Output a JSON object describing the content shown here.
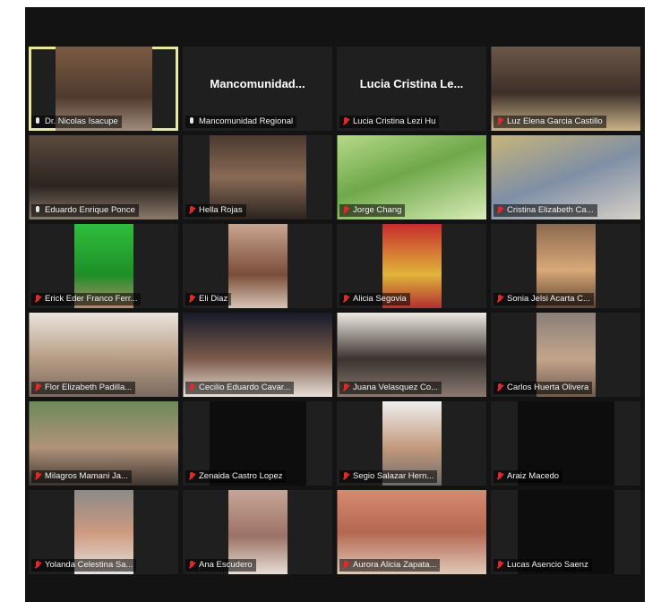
{
  "app": {
    "name": "Zoom",
    "view": "Gallery View"
  },
  "colors": {
    "background": "#131313",
    "tile": "#1f1f1f",
    "active_speaker": "#e8e8a0",
    "muted_mic": "#e02a2a"
  },
  "participants": [
    {
      "name": "Dr. Nicolas Isacupe",
      "muted": false,
      "active": true,
      "video": "on",
      "swatch": 0
    },
    {
      "name": "Mancomunidad Regional",
      "display_title": "Mancomunidad...",
      "muted": false,
      "video": "off"
    },
    {
      "name": "Lucia Cristina Lezi Hu",
      "display_title": "Lucia Cristina Le...",
      "muted": true,
      "video": "off"
    },
    {
      "name": "Luz Elena Garcia Castillo",
      "muted": true,
      "video": "on",
      "swatch": 1
    },
    {
      "name": "Eduardo Enrique Ponce",
      "muted": false,
      "video": "on",
      "swatch": 2
    },
    {
      "name": "Hella Rojas",
      "muted": true,
      "video": "on",
      "swatch": 10
    },
    {
      "name": "Jorge Chang",
      "muted": true,
      "video": "on",
      "swatch": 3
    },
    {
      "name": "Cristina Elizabeth Ca...",
      "muted": true,
      "video": "on",
      "swatch": 13
    },
    {
      "name": "Erick Eder Franco Ferr...",
      "muted": true,
      "video": "on",
      "swatch": 5
    },
    {
      "name": "Eli Diaz",
      "muted": true,
      "video": "on",
      "swatch": 6
    },
    {
      "name": "Alicia Segovia",
      "muted": true,
      "video": "on",
      "swatch": 7
    },
    {
      "name": "Sonia Jelsi Acarta C...",
      "muted": true,
      "video": "on",
      "swatch": 8
    },
    {
      "name": "Flor Elizabeth Padilla...",
      "muted": true,
      "video": "on",
      "swatch": 9
    },
    {
      "name": "Cecilio Eduardo Cavar...",
      "muted": true,
      "video": "on",
      "swatch": 12
    },
    {
      "name": "Juana Velasquez Co...",
      "muted": true,
      "video": "on",
      "swatch": 11
    },
    {
      "name": "Carlos Huerta Olivera",
      "muted": true,
      "video": "on",
      "swatch": 4
    },
    {
      "name": "Milagros Mamani Ja...",
      "muted": true,
      "video": "on",
      "swatch": 20
    },
    {
      "name": "Zenaida Castro Lopez",
      "muted": true,
      "video": "on",
      "swatch": 14
    },
    {
      "name": "Segio Salazar Hern...",
      "muted": true,
      "video": "on",
      "swatch": 15
    },
    {
      "name": "Araiz Macedo",
      "muted": true,
      "video": "on",
      "swatch": 14
    },
    {
      "name": "Yolanda Celestina Sa...",
      "muted": true,
      "video": "on",
      "swatch": 16
    },
    {
      "name": "Ana Escudero",
      "muted": true,
      "video": "on",
      "swatch": 17
    },
    {
      "name": "Aurora Alicia Zapata...",
      "muted": true,
      "video": "on",
      "swatch": 18
    },
    {
      "name": "Lucas Asencio Saenz",
      "muted": true,
      "video": "on",
      "swatch": 14
    }
  ]
}
